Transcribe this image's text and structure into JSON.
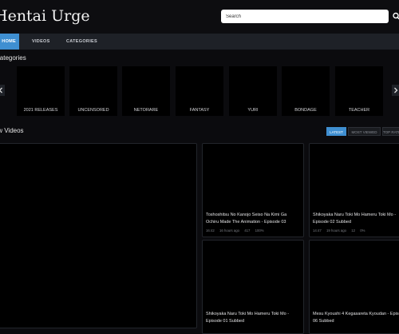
{
  "site": {
    "title": "Hentai Urge"
  },
  "search": {
    "placeholder": "Search"
  },
  "nav": {
    "items": [
      "HOME",
      "VIDEOS",
      "CATEGORIES"
    ]
  },
  "categories_section": {
    "title": "Categories",
    "items": [
      "2021 RELEASES",
      "UNCENSORED",
      "NETORARE",
      "FANTASY",
      "YURI",
      "BONDAGE",
      "TEACHER"
    ]
  },
  "videos_section": {
    "title": "New Videos",
    "filters": [
      "LATEST",
      "MOST VIEWED",
      "TOP RATED"
    ],
    "videos": [
      {
        "title": "Toshoshitsu No Kanojo Seiso Na Kimi Ga Ochiru Made The Animation - Episode 03",
        "duration": "16:42",
        "age": "16 hours ago",
        "views": "417",
        "rating": "100%"
      },
      {
        "title": "Shikoyaka Naru Toki Mo Hameru Toki Mo - Episode 02 Subbed",
        "duration": "14:47",
        "age": "19 hours ago",
        "views": "12",
        "rating": "0%"
      },
      {
        "title": "Shikoyaka Naru Toki Mo Hameru Toki Mo - Episode 01 Subbed",
        "duration": "",
        "age": "",
        "views": "",
        "rating": ""
      },
      {
        "title": "Mesu Kyoushi 4 Kegasareta Kyoudan - Episode 06 Subbed",
        "duration": "",
        "age": "",
        "views": "",
        "rating": ""
      }
    ]
  },
  "colors": {
    "accent": "#3f8fd1",
    "background": "#0b0b0e",
    "nav": "#1e2127"
  },
  "icons": {
    "search": "search-icon",
    "prev": "chevron-left-icon",
    "next": "chevron-right-icon"
  }
}
